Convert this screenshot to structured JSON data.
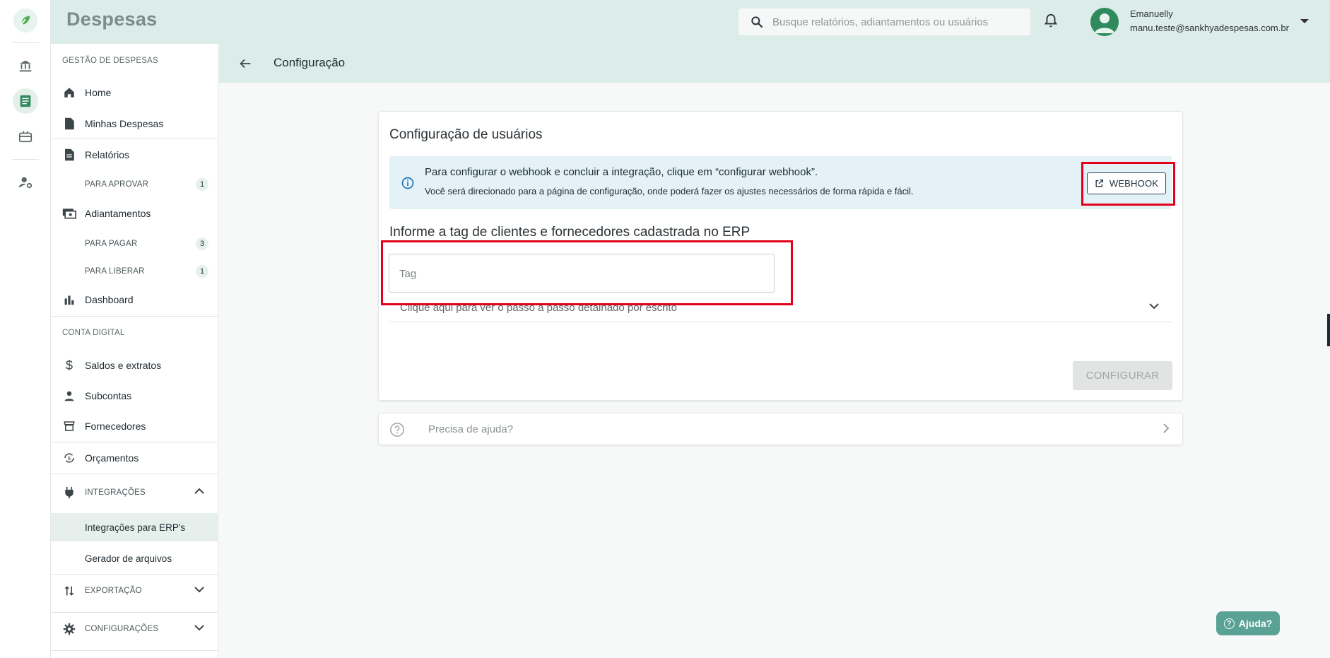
{
  "app": {
    "brand": "Despesas"
  },
  "header": {
    "search_placeholder": "Busque relatórios, adiantamentos ou usuários",
    "user_name": "Emanuelly",
    "user_email": "manu.teste@sankhyadespesas.com.br"
  },
  "sidebar": {
    "section_expenses": "GESTÃO DE DESPESAS",
    "home": "Home",
    "my_expenses": "Minhas Despesas",
    "reports": "Relatórios",
    "to_approve": "PARA APROVAR",
    "to_approve_count": "1",
    "advances": "Adiantamentos",
    "to_pay": "PARA PAGAR",
    "to_pay_count": "3",
    "to_release": "PARA LIBERAR",
    "to_release_count": "1",
    "dashboard": "Dashboard",
    "section_account": "CONTA DIGITAL",
    "balances": "Saldos e extratos",
    "subaccounts": "Subcontas",
    "suppliers": "Fornecedores",
    "budgets": "Orçamentos",
    "integrations": "INTEGRAÇÕES",
    "erp_integrations": "Integrações para ERP's",
    "file_generator": "Gerador de arquivos",
    "export": "EXPORTAÇÃO",
    "settings": "CONFIGURAÇÕES"
  },
  "page": {
    "title": "Configuração",
    "card_title": "Configuração de usuários",
    "alert_line1": "Para configurar o webhook e concluir a integração, clique em “configurar webhook”.",
    "alert_line2": "Você será direcionado para a página de configuração, onde poderá fazer os ajustes necessários de forma rápida e fácil.",
    "webhook_label": "WEBHOOK",
    "tag_heading": "Informe a tag de clientes e fornecedores cadastrada no ERP",
    "tag_placeholder": "Tag",
    "expander_label": "Clique aqui para ver o passo a passo detalhado por escrito",
    "configure_label": "CONFIGURAR",
    "help_label": "Precisa de ajuda?",
    "fab_label": "Ajuda?"
  },
  "colors": {
    "accent": "#2f8a5e",
    "header_bg": "#dcece8",
    "highlight": "#e3001b",
    "alert_bg": "#e4f2f8"
  }
}
